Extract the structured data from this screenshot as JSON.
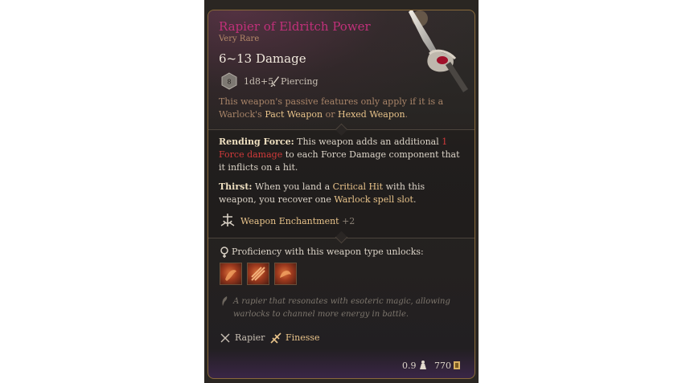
{
  "item": {
    "name": "Rapier of Eldritch Power",
    "rarity": "Very Rare",
    "damage": "6~13 Damage",
    "die_face": "8",
    "damage_roll": "1d8+5",
    "damage_type": "Piercing"
  },
  "passive": {
    "prefix": "This weapon's passive features only apply if it is a Warlock's",
    "pact": "Pact Weapon",
    "or": "or",
    "hexed": "Hexed Weapon",
    "end": "."
  },
  "rending_force": {
    "label": "Rending Force:",
    "text1": "This weapon adds an additional",
    "highlight": "1 Force damage",
    "text2": "to each Force Damage component that it inflicts on a hit."
  },
  "thirst": {
    "label": "Thirst:",
    "text1": "When you land a",
    "critical": "Critical Hit",
    "text2": "with this weapon, you recover one",
    "slot": "Warlock spell slot",
    "end": "."
  },
  "enchantment": {
    "label": "Weapon Enchantment",
    "bonus": "+2"
  },
  "proficiency": {
    "label": "Proficiency with this weapon type unlocks:"
  },
  "lore": "A rapier that resonates with esoteric magic, allowing warlocks to channel more energy in battle.",
  "properties": {
    "type": "Rapier",
    "trait": "Finesse"
  },
  "footer": {
    "weight": "0.9",
    "price": "770"
  },
  "colors": {
    "title": "#c0307a",
    "gold": "#e8c38a",
    "damage_red": "#d23a3a",
    "border": "#8a6a3a"
  },
  "icons": [
    "d8-die-icon",
    "dagger-icon",
    "weapon-enchantment-icon",
    "proficiency-icon",
    "action-icon",
    "lore-feather-icon",
    "rapier-icon",
    "finesse-icon",
    "weight-icon",
    "gold-coin-icon"
  ]
}
